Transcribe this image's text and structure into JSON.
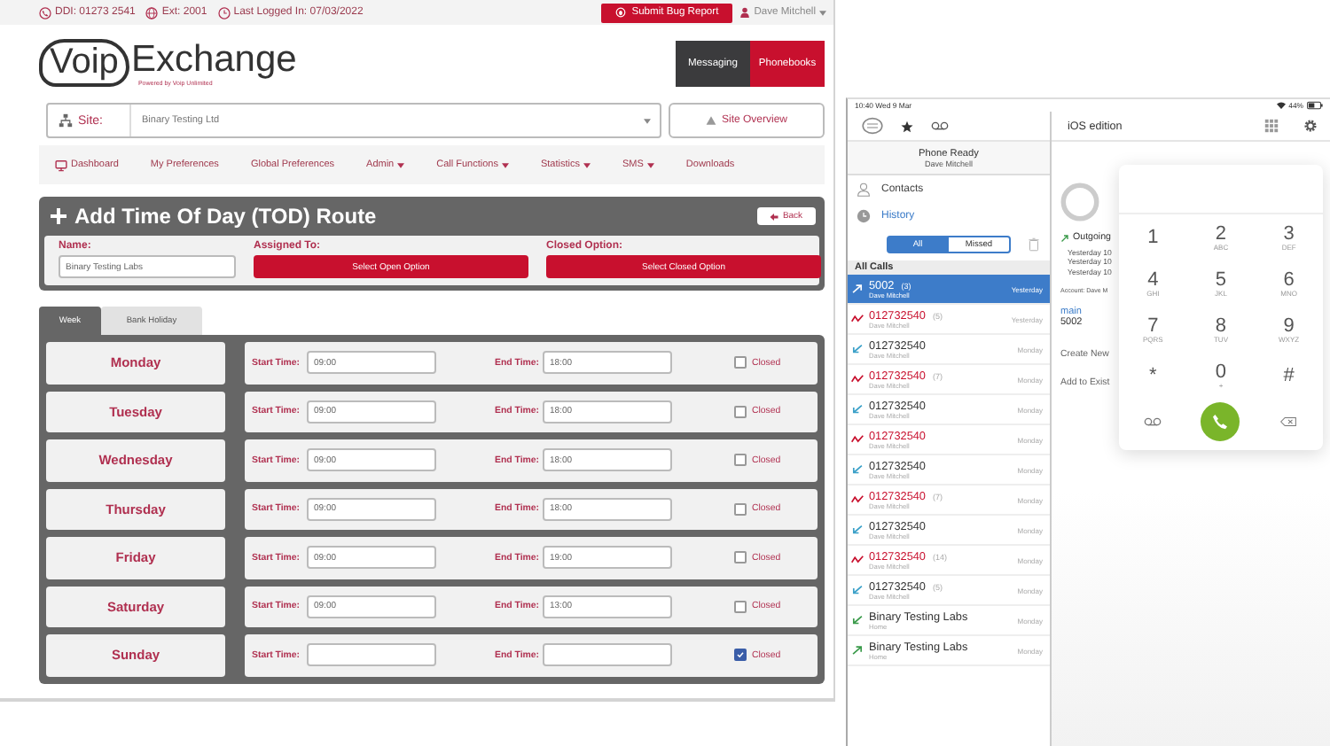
{
  "topbar": {
    "ddi": "DDI: 01273 2541",
    "ext": "Ext: 2001",
    "last_logged": "Last Logged In: 07/03/2022",
    "bug_button": "Submit Bug Report",
    "user": "Dave Mitchell"
  },
  "logo": {
    "voip": "Voip",
    "exchange": "Exchange",
    "tagline": "Powered by Voip Unlimited"
  },
  "header_buttons": [
    {
      "label": "Messaging",
      "selected": false
    },
    {
      "label": "Phonebooks",
      "selected": true
    }
  ],
  "site": {
    "label": "Site:",
    "value": "Binary Testing Ltd",
    "overview_button": "Site Overview"
  },
  "nav": [
    {
      "label": "Dashboard",
      "kind": "icon",
      "dropdown": false
    },
    {
      "label": "My Preferences",
      "kind": "plain",
      "dropdown": false
    },
    {
      "label": "Global Preferences",
      "kind": "plain",
      "dropdown": false
    },
    {
      "label": "Admin",
      "kind": "plain",
      "dropdown": true
    },
    {
      "label": "Call Functions",
      "kind": "plain",
      "dropdown": true
    },
    {
      "label": "Statistics",
      "kind": "plain",
      "dropdown": true
    },
    {
      "label": "SMS",
      "kind": "plain",
      "dropdown": true
    },
    {
      "label": "Downloads",
      "kind": "plain",
      "dropdown": false
    }
  ],
  "tod": {
    "title": "Add Time Of Day (TOD) Route",
    "back": "Back",
    "name_label": "Name:",
    "name_value": "Binary Testing Labs",
    "assigned_label": "Assigned To:",
    "assigned_button": "Select Open Option",
    "closed_label": "Closed Option:",
    "closed_button": "Select Closed Option"
  },
  "schedule_tabs": [
    {
      "label": "Week",
      "selected": true
    },
    {
      "label": "Bank Holiday",
      "selected": false
    }
  ],
  "days": [
    {
      "day": "Monday",
      "start_label": "Start Time:",
      "start": "09:00",
      "end_label": "End Time:",
      "end": "18:00",
      "closed_label": "Closed",
      "closed": false
    },
    {
      "day": "Tuesday",
      "start_label": "Start Time:",
      "start": "09:00",
      "end_label": "End Time:",
      "end": "18:00",
      "closed_label": "Closed",
      "closed": false
    },
    {
      "day": "Wednesday",
      "start_label": "Start Time:",
      "start": "09:00",
      "end_label": "End Time:",
      "end": "18:00",
      "closed_label": "Closed",
      "closed": false
    },
    {
      "day": "Thursday",
      "start_label": "Start Time:",
      "start": "09:00",
      "end_label": "End Time:",
      "end": "18:00",
      "closed_label": "Closed",
      "closed": false
    },
    {
      "day": "Friday",
      "start_label": "Start Time:",
      "start": "09:00",
      "end_label": "End Time:",
      "end": "19:00",
      "closed_label": "Closed",
      "closed": false
    },
    {
      "day": "Saturday",
      "start_label": "Start Time:",
      "start": "09:00",
      "end_label": "End Time:",
      "end": "13:00",
      "closed_label": "Closed",
      "closed": false
    },
    {
      "day": "Sunday",
      "start_label": "Start Time:",
      "end_label": "End Time:",
      "closed_label": "Closed",
      "closed": true
    }
  ],
  "ipad": {
    "status_time": "10:40  Wed 9 Mar",
    "battery": "44%",
    "phone_status": "Phone Ready",
    "user": "Dave Mitchell",
    "contacts": "Contacts",
    "history": "History",
    "filters": [
      {
        "label": "All",
        "selected": true
      },
      {
        "label": "Missed",
        "selected": false
      }
    ],
    "list_title": "All Calls",
    "calls": [
      {
        "number": "5002",
        "count": "(3)",
        "name": "Dave Mitchell",
        "when": "Yesterday",
        "kind": "outgoing",
        "selected": true
      },
      {
        "number": "012732540",
        "count": "(5)",
        "name": "Dave Mitchell",
        "when": "Yesterday",
        "kind": "missed",
        "selected": false
      },
      {
        "number": "012732540",
        "name": "Dave Mitchell",
        "when": "Monday",
        "kind": "incoming",
        "selected": false
      },
      {
        "number": "012732540",
        "count": "(7)",
        "name": "Dave Mitchell",
        "when": "Monday",
        "kind": "missed",
        "selected": false
      },
      {
        "number": "012732540",
        "name": "Dave Mitchell",
        "when": "Monday",
        "kind": "incoming",
        "selected": false
      },
      {
        "number": "012732540",
        "name": "Dave Mitchell",
        "when": "Monday",
        "kind": "missed",
        "selected": false
      },
      {
        "number": "012732540",
        "name": "Dave Mitchell",
        "when": "Monday",
        "kind": "incoming",
        "selected": false
      },
      {
        "number": "012732540",
        "count": "(7)",
        "name": "Dave Mitchell",
        "when": "Monday",
        "kind": "missed",
        "selected": false
      },
      {
        "number": "012732540",
        "name": "Dave Mitchell",
        "when": "Monday",
        "kind": "incoming",
        "selected": false
      },
      {
        "number": "012732540",
        "count": "(14)",
        "name": "Dave Mitchell",
        "when": "Monday",
        "kind": "missed",
        "selected": false
      },
      {
        "number": "012732540",
        "count": "(5)",
        "name": "Dave Mitchell",
        "when": "Monday",
        "kind": "incoming",
        "selected": false
      },
      {
        "number": "Binary Testing Labs",
        "name": "Home",
        "when": "Monday",
        "kind": "answered",
        "selected": false
      },
      {
        "number": "Binary Testing Labs",
        "name": "Home",
        "when": "Monday",
        "kind": "outgoing",
        "selected": false
      }
    ],
    "detail": {
      "title": "iOS edition",
      "direction": "Outgoing",
      "times": [
        "Yesterday 10",
        "Yesterday 10",
        "Yesterday 10"
      ],
      "account": "Account: Dave M",
      "number_label": "main",
      "number": "5002",
      "actions": [
        "Create New",
        "Add to Exist"
      ]
    },
    "keys": [
      {
        "kind": "digit",
        "digit": "1"
      },
      {
        "kind": "digit",
        "digit": "2",
        "letters": "ABC"
      },
      {
        "kind": "digit",
        "digit": "3",
        "letters": "DEF"
      },
      {
        "kind": "digit",
        "digit": "4",
        "letters": "GHI"
      },
      {
        "kind": "digit",
        "digit": "5",
        "letters": "JKL"
      },
      {
        "kind": "digit",
        "digit": "6",
        "letters": "MNO"
      },
      {
        "kind": "digit",
        "digit": "7",
        "letters": "PQRS"
      },
      {
        "kind": "digit",
        "digit": "8",
        "letters": "TUV"
      },
      {
        "kind": "digit",
        "digit": "9",
        "letters": "WXYZ"
      },
      {
        "kind": "digit",
        "digit": "*"
      },
      {
        "kind": "digit",
        "digit": "0",
        "letters": "+"
      },
      {
        "kind": "digit",
        "digit": "#"
      },
      {
        "kind": "voicemail"
      },
      {
        "kind": "call"
      },
      {
        "kind": "delete"
      }
    ]
  }
}
